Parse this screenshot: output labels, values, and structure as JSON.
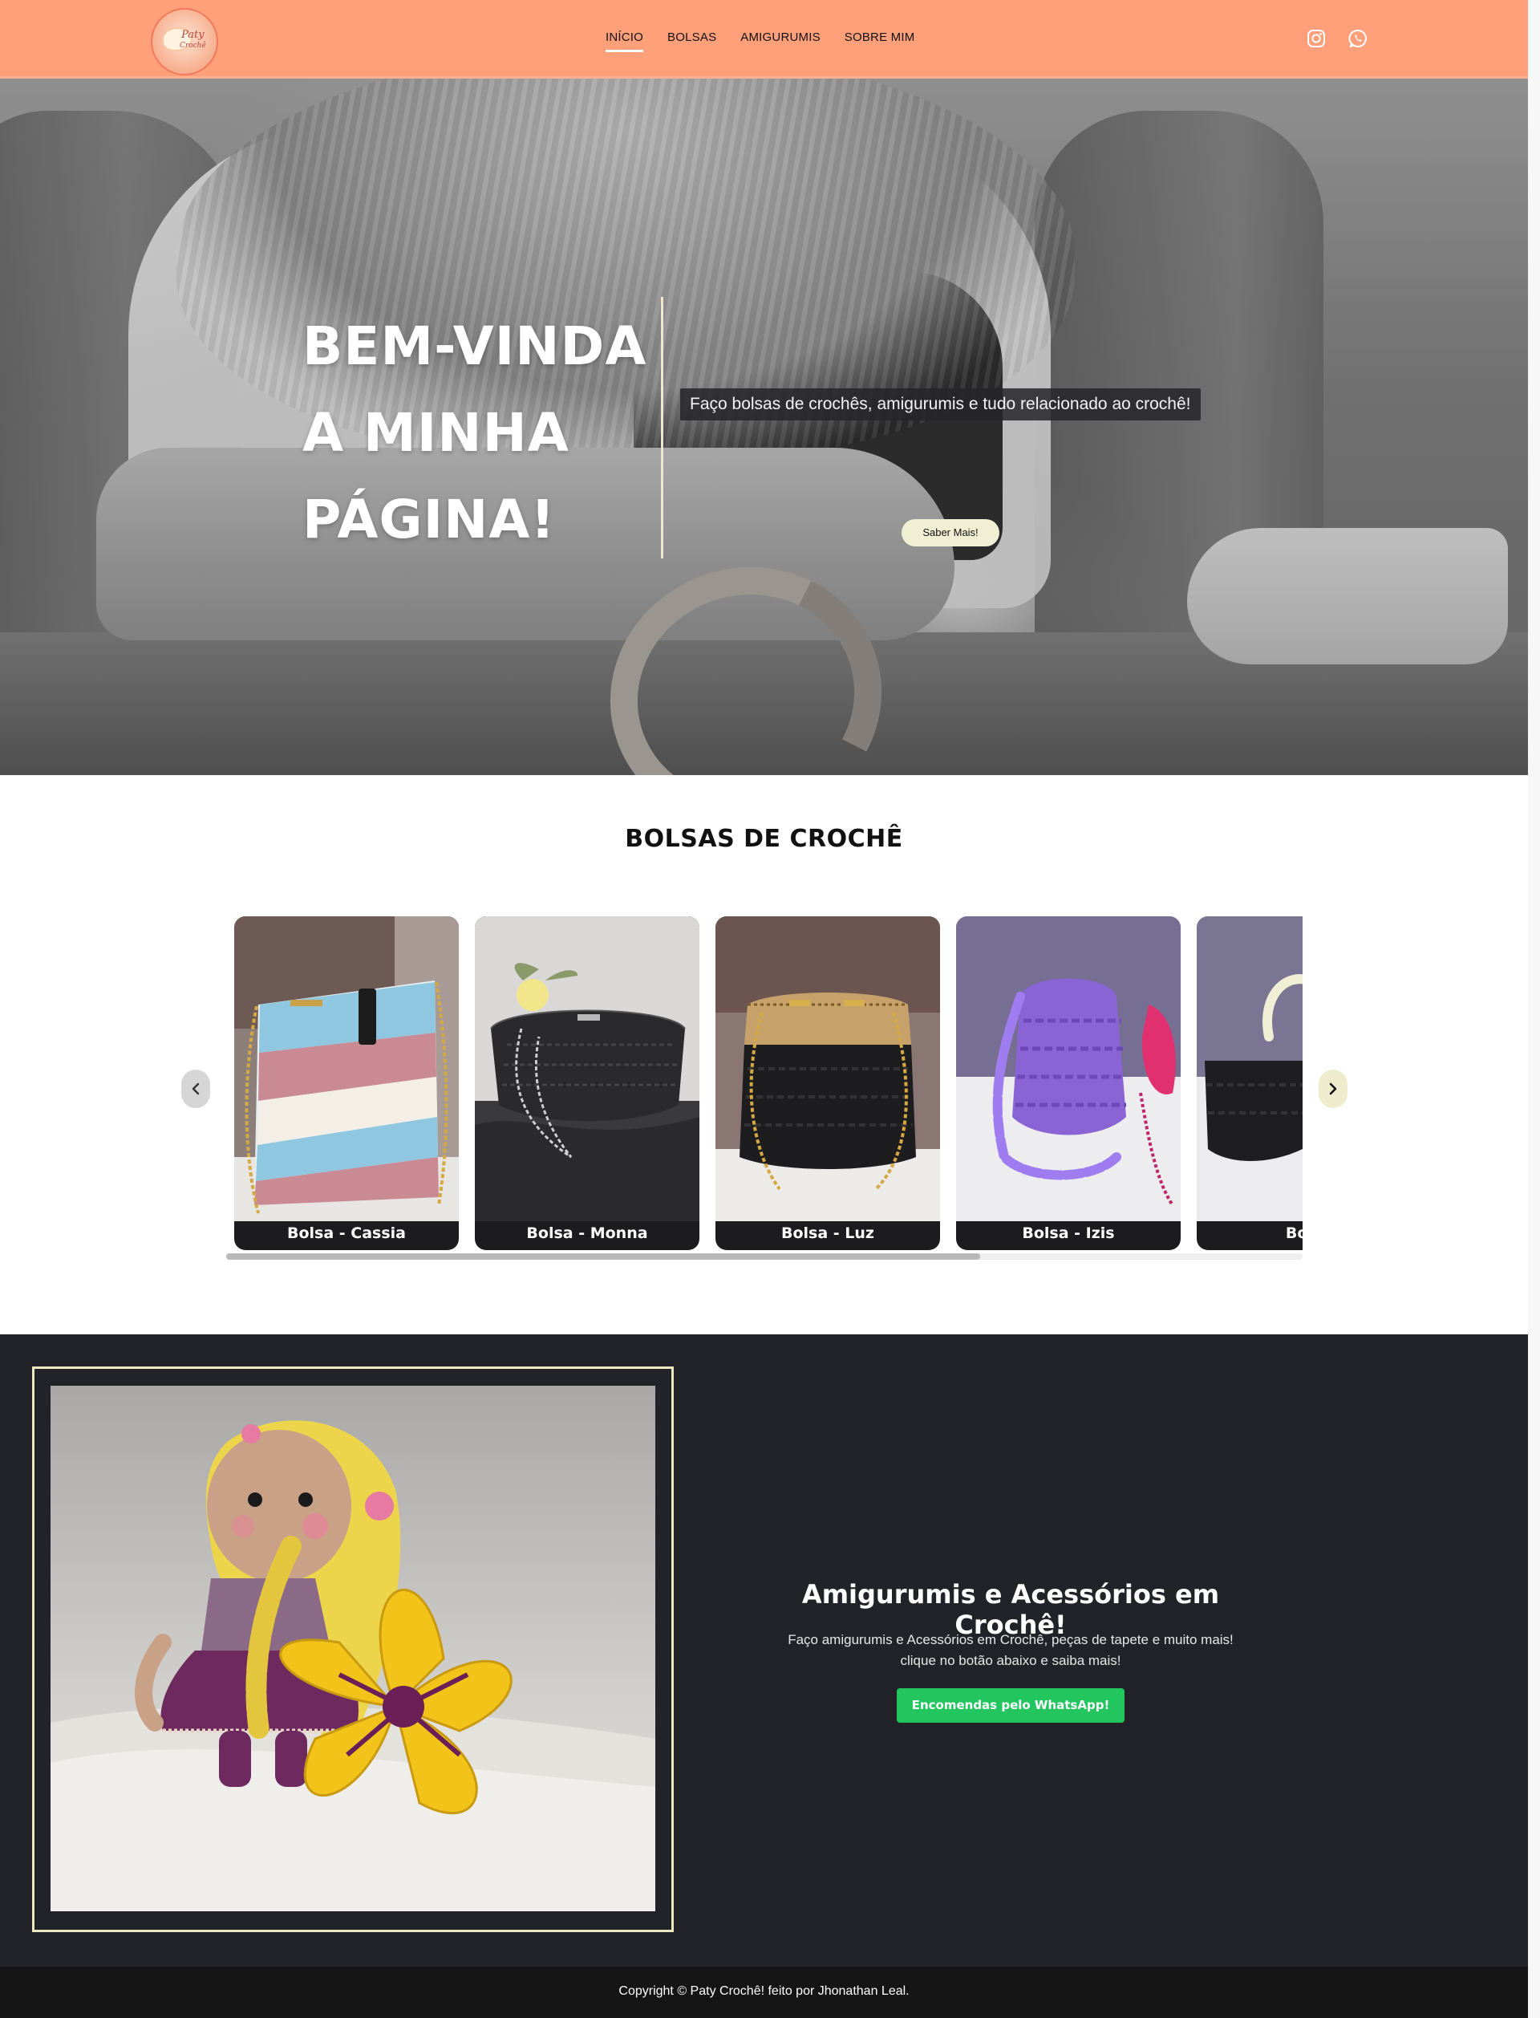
{
  "header": {
    "logo": {
      "line1": "Paty",
      "line2": "Crochê"
    },
    "nav": [
      {
        "label": "INÍCIO",
        "active": true
      },
      {
        "label": "BOLSAS",
        "active": false
      },
      {
        "label": "AMIGURUMIS",
        "active": false
      },
      {
        "label": "SOBRE MIM",
        "active": false
      }
    ],
    "social": [
      "instagram-icon",
      "whatsapp-icon"
    ],
    "bg_color": "#ffa07a"
  },
  "hero": {
    "title_line1": "BEM-VINDA",
    "title_line2": "A MINHA",
    "title_line3": "PÁGINA!",
    "tagline": "Faço bolsas de crochês, amigurumis e tudo relacionado ao crochê!",
    "button_label": "Saber Mais!"
  },
  "bags": {
    "title": "BOLSAS DE CROCHÊ",
    "items": [
      {
        "label": "Bolsa - Cassia"
      },
      {
        "label": "Bolsa - Monna"
      },
      {
        "label": "Bolsa - Luz"
      },
      {
        "label": "Bolsa - Izis"
      },
      {
        "label": "Bolsa"
      }
    ]
  },
  "amigurumi": {
    "title": "Amigurumis e Acessórios em Crochê!",
    "description": "Faço amigurumis e Acessórios em Crochê, peças de tapete e muito mais!\nclique no botão abaixo e saiba mais!",
    "button_label": "Encomendas pelo WhatsApp!",
    "accent_color": "#22c55e"
  },
  "footer": {
    "text": "Copyright © Paty Crochê! feito por Jhonathan Leal."
  }
}
